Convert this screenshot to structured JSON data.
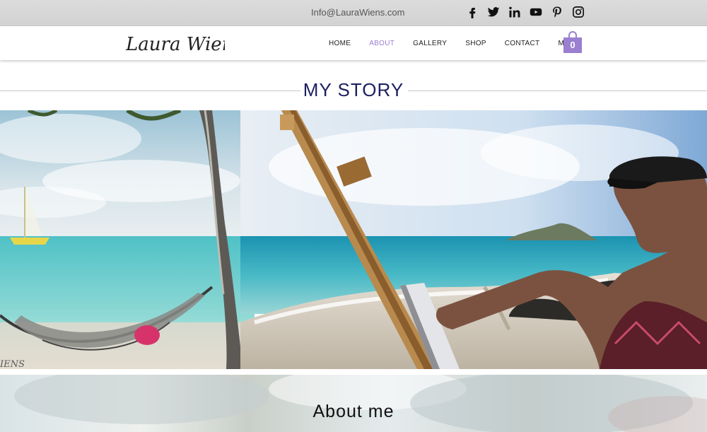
{
  "topbar": {
    "email": "Info@LauraWiens.com",
    "socials": [
      "facebook-icon",
      "twitter-icon",
      "linkedin-icon",
      "youtube-icon",
      "pinterest-icon",
      "instagram-icon"
    ]
  },
  "header": {
    "logo_text": "Laura Wiens",
    "nav": [
      "HOME",
      "ABOUT",
      "GALLERY",
      "SHOP",
      "CONTACT",
      "More"
    ],
    "active_nav": "ABOUT",
    "cart_count": "0",
    "accent_color": "#9b7fd1"
  },
  "main": {
    "section_title": "MY STORY",
    "hero_signature": "IENS",
    "about_title": "About me"
  }
}
